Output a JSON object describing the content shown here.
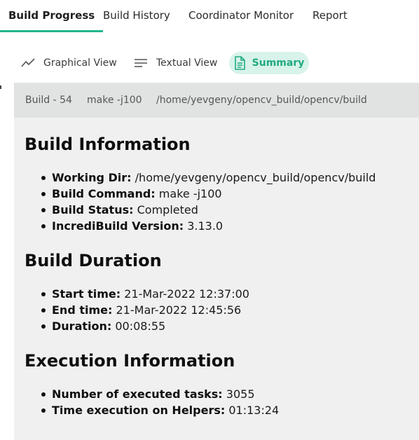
{
  "top_tabs": [
    {
      "label": "Build Progress",
      "active": true
    },
    {
      "label": "Build History",
      "active": false
    },
    {
      "label": "Coordinator Monitor",
      "active": false
    },
    {
      "label": "Report",
      "active": false
    }
  ],
  "accent_color": "#21b58c",
  "views": [
    {
      "label": "Graphical View",
      "icon": "line-chart-icon",
      "active": false
    },
    {
      "label": "Textual View",
      "icon": "text-lines-icon",
      "active": false
    },
    {
      "label": "Summary",
      "icon": "document-icon",
      "active": true
    }
  ],
  "header": {
    "build": "Build - 54",
    "command": "make -j100",
    "directory": "/home/yevgeny/opencv_build/opencv/build"
  },
  "sections": [
    {
      "title": "Build Information",
      "items": [
        {
          "label": "Working Dir:",
          "value": "/home/yevgeny/opencv_build/opencv/build"
        },
        {
          "label": "Build Command:",
          "value": "make -j100"
        },
        {
          "label": "Build Status:",
          "value": "Completed"
        },
        {
          "label": "IncrediBuild Version:",
          "value": "3.13.0"
        }
      ]
    },
    {
      "title": "Build Duration",
      "items": [
        {
          "label": "Start time:",
          "value": "21-Mar-2022 12:37:00"
        },
        {
          "label": "End time:",
          "value": "21-Mar-2022 12:45:56"
        },
        {
          "label": "Duration:",
          "value": "00:08:55"
        }
      ]
    },
    {
      "title": "Execution Information",
      "items": [
        {
          "label": "Number of executed tasks:",
          "value": "3055"
        },
        {
          "label": "Time execution on Helpers:",
          "value": "01:13:24"
        }
      ]
    }
  ]
}
